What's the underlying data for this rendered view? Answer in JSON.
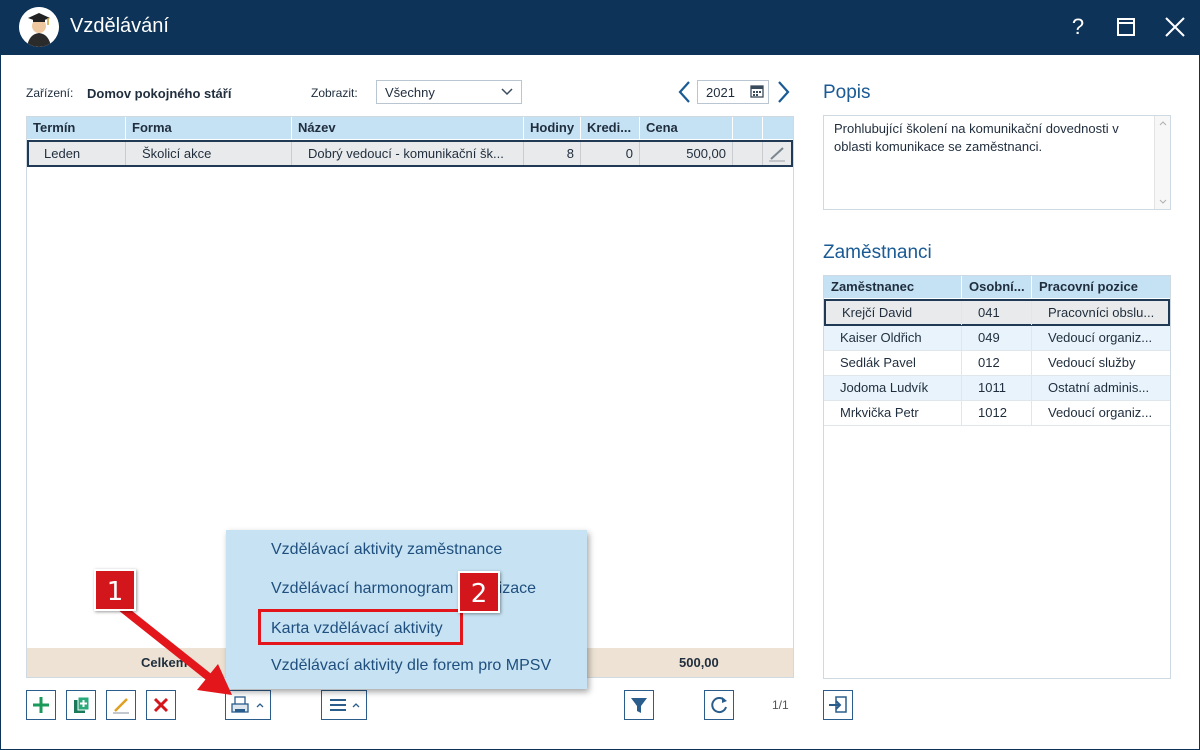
{
  "window": {
    "title": "Vzdělávání",
    "help_icon": "?",
    "accent": "#0d3358"
  },
  "filters": {
    "facility_label": "Zařízení:",
    "facility_value": "Domov pokojného stáří",
    "show_label": "Zobrazit:",
    "show_value": "Všechny",
    "year": "2021"
  },
  "grid": {
    "columns": [
      "Termín",
      "Forma",
      "Název",
      "Hodiny",
      "Kredi...",
      "Cena"
    ],
    "rows": [
      {
        "termin": "Leden",
        "forma": "Školicí akce",
        "nazev": "Dobrý vedoucí - komunikační šk...",
        "hodiny": "8",
        "kredity": "0",
        "cena": "500,00"
      }
    ],
    "footer_label": "Celkem",
    "footer_total": "500,00"
  },
  "popis": {
    "title": "Popis",
    "text": "Prohlubující školení na komunikační dovednosti v oblasti komunikace se zaměstnanci."
  },
  "zamestnanci": {
    "title": "Zaměstnanci",
    "columns": [
      "Zaměstnanec",
      "Osobní...",
      "Pracovní pozice"
    ],
    "rows": [
      {
        "name": "Krejčí David",
        "id": "041",
        "position": "Pracovníci obslu..."
      },
      {
        "name": "Kaiser Oldřich",
        "id": "049",
        "position": "Vedoucí organiz..."
      },
      {
        "name": "Sedlák Pavel",
        "id": "012",
        "position": "Vedoucí služby"
      },
      {
        "name": "Jodoma Ludvík",
        "id": "1011",
        "position": "Ostatní adminis..."
      },
      {
        "name": "Mrkvička Petr",
        "id": "1012",
        "position": "Vedoucí organiz..."
      }
    ]
  },
  "menu": {
    "items": [
      "Vzdělávací aktivity zaměstnance",
      "Vzdělávací harmonogram organizace",
      "Karta vzdělávací aktivity",
      "Vzdělávací aktivity dle forem pro MPSV"
    ]
  },
  "badges": {
    "one": "1",
    "two": "2"
  },
  "pager": "1/1"
}
